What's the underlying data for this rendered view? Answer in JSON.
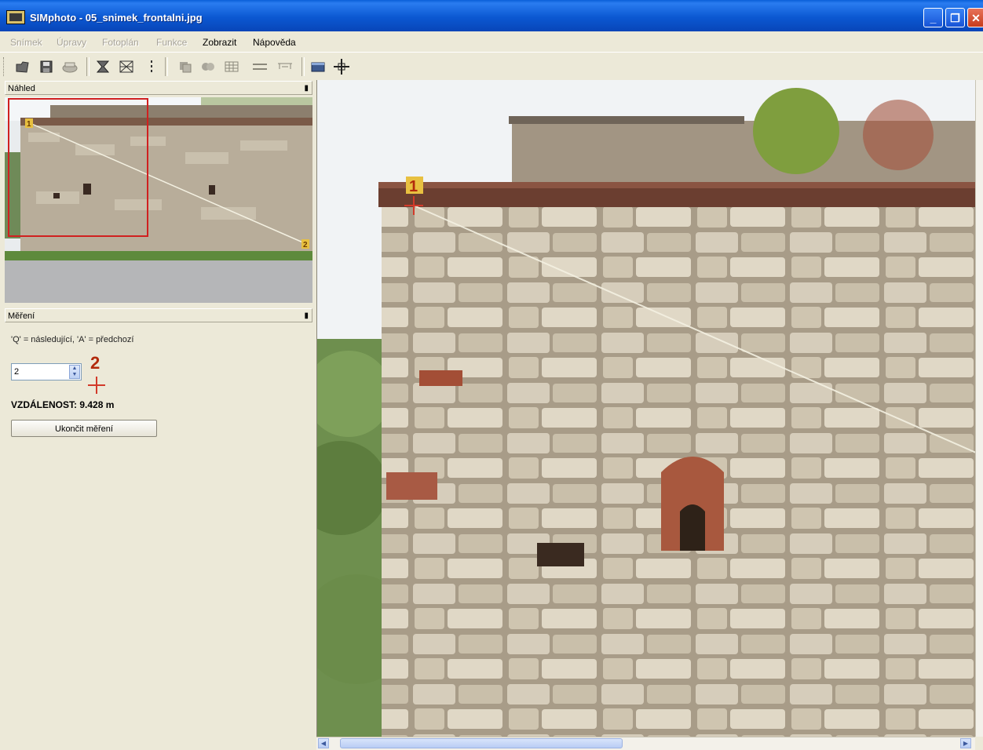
{
  "window": {
    "title": "SIMphoto - 05_snimek_frontalni.jpg",
    "min_glyph": "_",
    "max_glyph": "❐",
    "close_glyph": "✕"
  },
  "menu": {
    "items": [
      {
        "label": "Snímek",
        "enabled": false
      },
      {
        "label": "Úpravy",
        "enabled": false
      },
      {
        "label": "Fotoplán",
        "enabled": false
      },
      {
        "label": "Funkce",
        "enabled": false
      },
      {
        "label": "Zobrazit",
        "enabled": true
      },
      {
        "label": "Nápověda",
        "enabled": true
      }
    ]
  },
  "toolbar": {
    "icons": [
      "open-icon",
      "save-icon",
      "print-icon",
      "rectify-icon",
      "transform-icon",
      "vertical-line-icon",
      "layers-icon",
      "mosaic-icon",
      "grid-icon",
      "horizontal-lines-icon",
      "scale-icon",
      "image-icon",
      "crosshair-icon"
    ]
  },
  "preview_panel": {
    "title": "Náhled",
    "point1": "1",
    "point2": "2"
  },
  "measure_panel": {
    "title": "Měření",
    "hint": "'Q' = následující, 'A' = předchozí",
    "point_value": "2",
    "point_marker": "2",
    "distance": "VZDÁLENOST: 9.428 m",
    "end_button": "Ukončit měření"
  },
  "main_view": {
    "point1": "1"
  },
  "colors": {
    "title_bar": "#0b58d2",
    "marker_red": "#d23a2a",
    "marker_label": "#b22a0c",
    "measure_line": "#f4f1e2"
  }
}
